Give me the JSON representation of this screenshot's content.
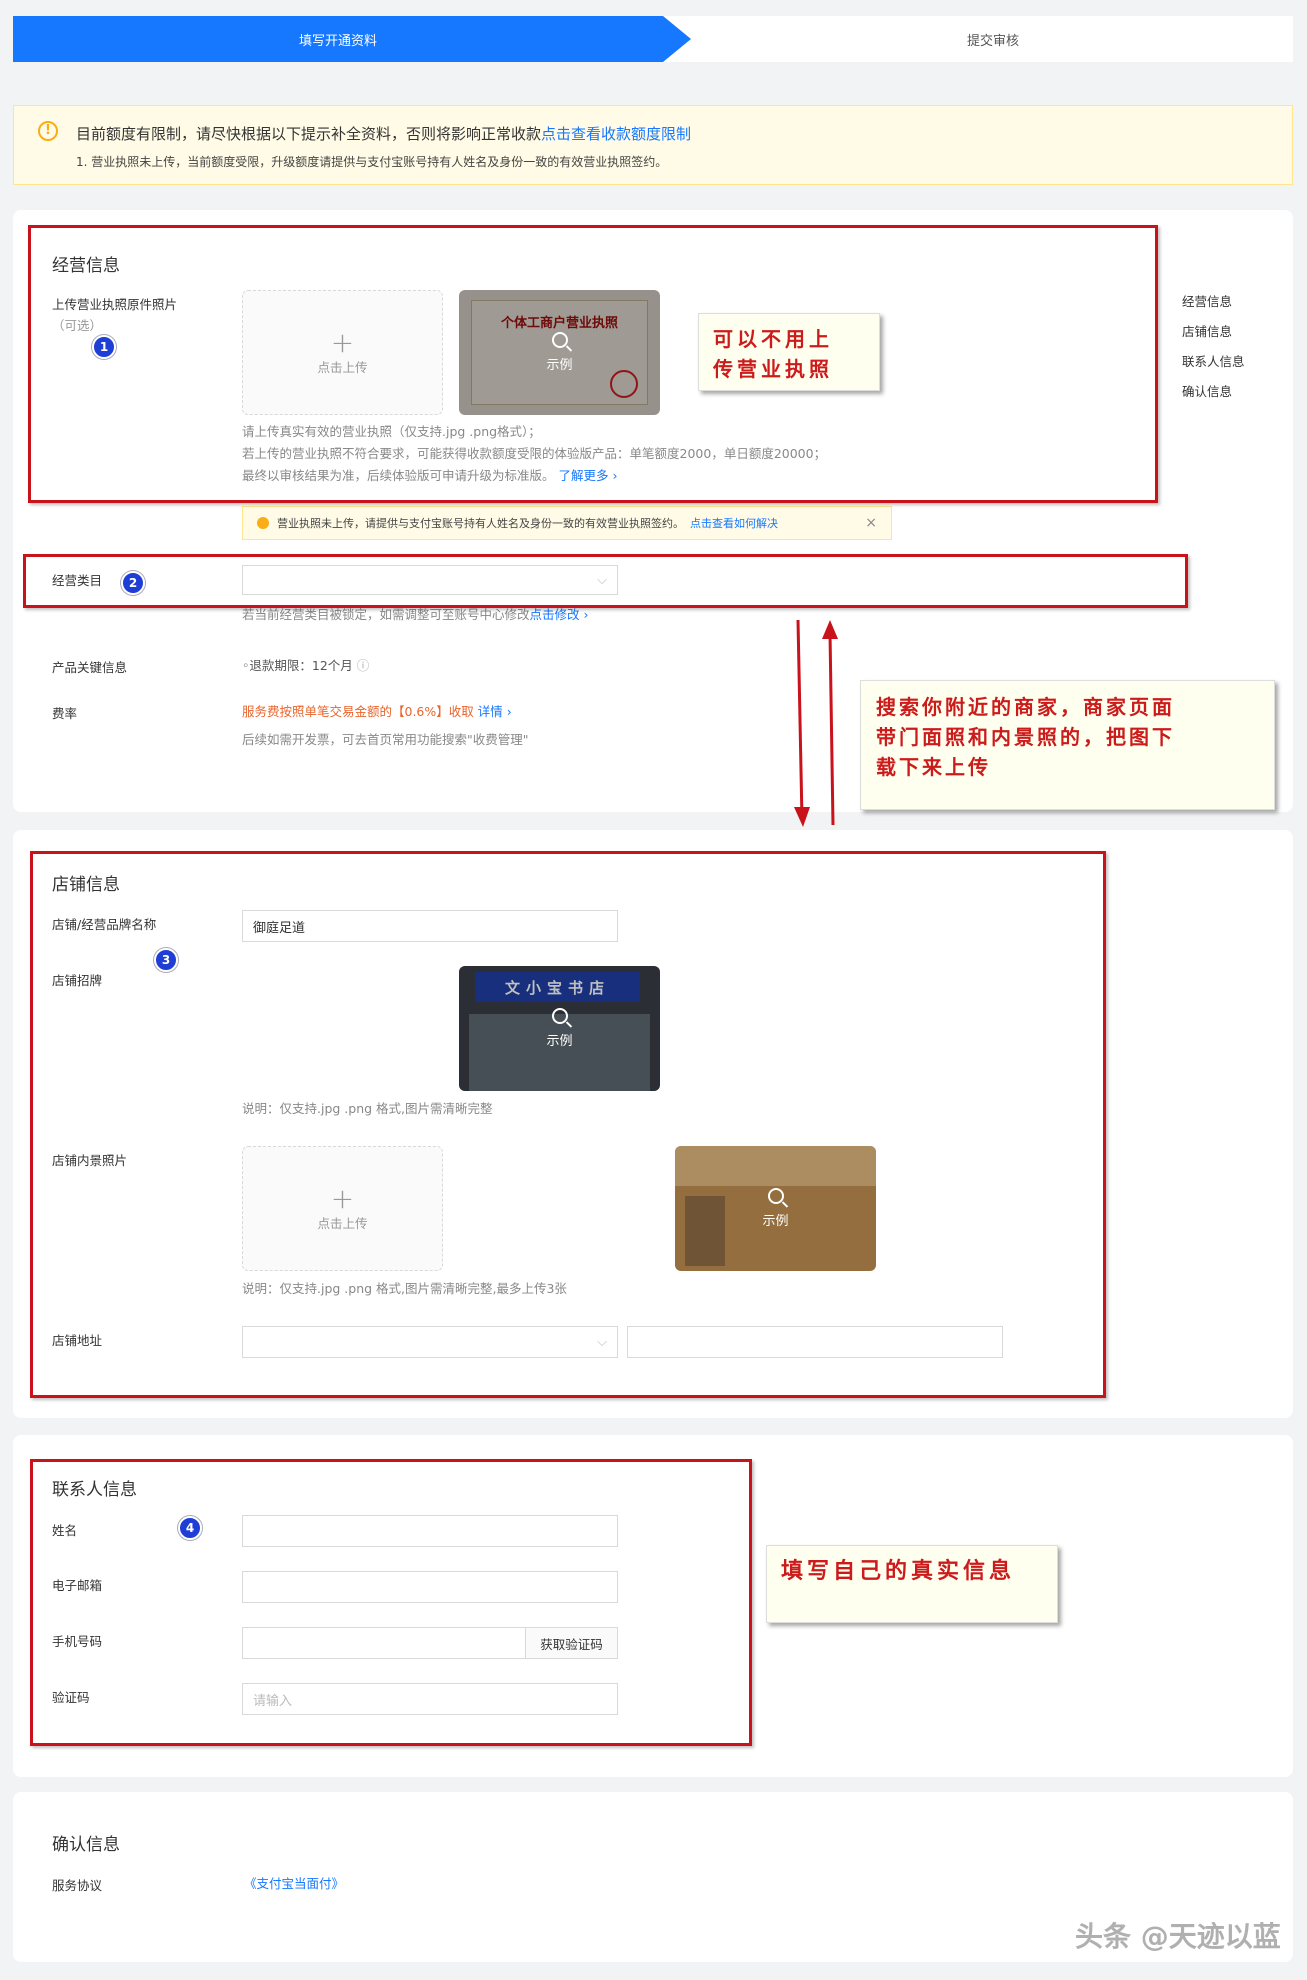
{
  "steps": {
    "step1": "填写开通资料",
    "step2": "提交审核"
  },
  "alert": {
    "title": "目前额度有限制，请尽快根据以下提示补全资料，否则将影响正常收款",
    "link": "点击查看收款额度限制",
    "sub": "1. 营业执照未上传，当前额度受限，升级额度请提供与支付宝账号持有人姓名及身份一致的有效营业执照签约。"
  },
  "side_nav": [
    "经营信息",
    "店铺信息",
    "联系人信息",
    "确认信息"
  ],
  "business": {
    "title": "经营信息",
    "license_label": "上传营业执照原件照片",
    "license_optional": "（可选）",
    "upload_text": "点击上传",
    "sample_text": "示例",
    "license_sample_title": "个体工商户营业执照",
    "hint1": "请上传真实有效的营业执照（仅支持.jpg .png格式）；",
    "hint2": "若上传的营业执照不符合要求，可能获得收款额度受限的体验版产品：单笔额度2000，单日额度20000；",
    "hint3": "最终以审核结果为准，后续体验版可申请升级为标准版。",
    "learn_more": "了解更多 ›",
    "warn_text": "营业执照未上传，请提供与支付宝账号持有人姓名及身份一致的有效营业执照签约。",
    "warn_link": "点击查看如何解决",
    "warn_close": "×",
    "category_label": "经营类目",
    "category_hint": "若当前经营类目被锁定，如需调整可至账号中心修改",
    "category_link": "点击修改 ›",
    "key_info_label": "产品关键信息",
    "key_info_value": "◦退款期限：12个月",
    "fee_label": "费率",
    "fee_value": "服务费按照单笔交易金额的【0.6%】收取",
    "fee_link": "详情 ›",
    "fee_hint": "后续如需开发票，可去首页常用功能搜索\"收费管理\""
  },
  "store": {
    "title": "店铺信息",
    "name_label": "店铺/经营品牌名称",
    "name_value": "御庭足道",
    "sign_label": "店铺招牌",
    "sign_sample_text": "文小宝书店",
    "sign_hint": "说明：仅支持.jpg .png 格式,图片需清晰完整",
    "interior_label": "店铺内景照片",
    "interior_hint": "说明：仅支持.jpg .png 格式,图片需清晰完整,最多上传3张",
    "address_label": "店铺地址"
  },
  "contact": {
    "title": "联系人信息",
    "name_label": "姓名",
    "email_label": "电子邮箱",
    "phone_label": "手机号码",
    "code_button": "获取验证码",
    "verify_label": "验证码",
    "verify_placeholder": "请输入"
  },
  "confirm": {
    "title": "确认信息",
    "agreement_label": "服务协议",
    "agreement_link": "《支付宝当面付》"
  },
  "annotations": {
    "note1_line1": "可以不用上",
    "note1_line2": "传营业执照",
    "note2_line1": "搜索你附近的商家，商家页面",
    "note2_line2": "带门面照和内景照的，把图下",
    "note2_line3": "载下来上传",
    "note3": "填写自己的真实信息",
    "badges": [
      "1",
      "2",
      "3",
      "4"
    ]
  },
  "watermark": "头条 @天迹以蓝"
}
